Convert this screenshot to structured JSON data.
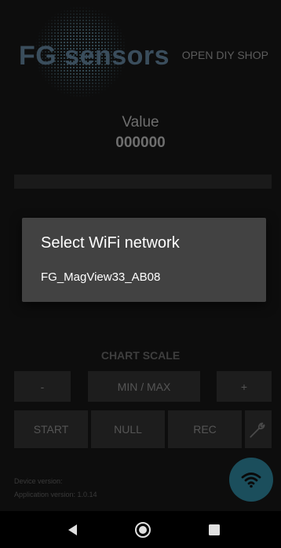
{
  "header": {
    "logo_text": "FG sensors",
    "shop_link": "OPEN DIY SHOP"
  },
  "reading": {
    "label": "Value",
    "value": "000000"
  },
  "chart": {
    "scale_label": "CHART SCALE",
    "minus_label": "-",
    "minmax_label": "MIN / MAX",
    "plus_label": "+"
  },
  "controls": {
    "start_label": "START",
    "null_label": "NULL",
    "rec_label": "REC",
    "settings_icon": "wrench-icon"
  },
  "footer": {
    "device_version": "Device version:",
    "app_version": "Application version: 1.0.14",
    "fab_icon": "wifi-icon"
  },
  "dialog": {
    "title": "Select WiFi network",
    "networks": [
      "FG_MagView33_AB08"
    ]
  },
  "navbar": {
    "back_icon": "back-triangle-icon",
    "home_icon": "home-circle-icon",
    "recents_icon": "recents-square-icon"
  },
  "colors": {
    "dialog_bg": "#424242",
    "fab_bg": "#1b4e5c",
    "logo": "#3a4d5c"
  }
}
